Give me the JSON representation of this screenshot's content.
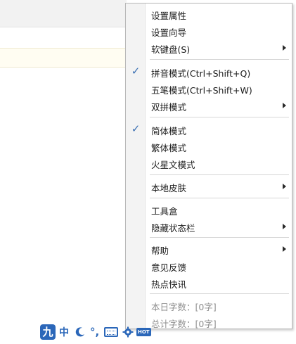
{
  "menu": {
    "groups": [
      {
        "items": [
          {
            "label": "设置属性",
            "checked": false,
            "submenu": false,
            "disabled": false
          },
          {
            "label": "设置向导",
            "checked": false,
            "submenu": false,
            "disabled": false
          },
          {
            "label": "软键盘(S)",
            "checked": false,
            "submenu": true,
            "disabled": false
          }
        ]
      },
      {
        "items": [
          {
            "label": "拼音模式(Ctrl+Shift+Q)",
            "checked": true,
            "submenu": false,
            "disabled": false
          },
          {
            "label": "五笔模式(Ctrl+Shift+W)",
            "checked": false,
            "submenu": false,
            "disabled": false
          },
          {
            "label": "双拼模式",
            "checked": false,
            "submenu": true,
            "disabled": false
          }
        ]
      },
      {
        "items": [
          {
            "label": "简体模式",
            "checked": true,
            "submenu": false,
            "disabled": false
          },
          {
            "label": "繁体模式",
            "checked": false,
            "submenu": false,
            "disabled": false
          },
          {
            "label": "火星文模式",
            "checked": false,
            "submenu": false,
            "disabled": false
          }
        ]
      },
      {
        "items": [
          {
            "label": "本地皮肤",
            "checked": false,
            "submenu": true,
            "disabled": false
          }
        ]
      },
      {
        "items": [
          {
            "label": "工具盒",
            "checked": false,
            "submenu": false,
            "disabled": false
          },
          {
            "label": "隐藏状态栏",
            "checked": false,
            "submenu": true,
            "disabled": false
          }
        ]
      },
      {
        "items": [
          {
            "label": "帮助",
            "checked": false,
            "submenu": true,
            "disabled": false
          },
          {
            "label": "意见反馈",
            "checked": false,
            "submenu": false,
            "disabled": false
          },
          {
            "label": "热点快讯",
            "checked": false,
            "submenu": false,
            "disabled": false
          }
        ]
      },
      {
        "items": [
          {
            "label": "本日字数：[0字]",
            "checked": false,
            "submenu": false,
            "disabled": true
          },
          {
            "label": "总计字数：[0字]",
            "checked": false,
            "submenu": false,
            "disabled": true
          }
        ]
      }
    ],
    "check_glyph": "✓",
    "check_color": "#3a6fb3"
  },
  "status_bar": {
    "logo_text": "九",
    "mode_text": "中",
    "punct_text": "°,",
    "hot_text": "HOT",
    "icons": [
      "ime-logo-icon",
      "chinese-mode-icon",
      "moon-halfwidth-icon",
      "punctuation-icon",
      "keyboard-icon",
      "gear-icon",
      "hot-badge-icon"
    ],
    "accent_color": "#2b67b9"
  }
}
